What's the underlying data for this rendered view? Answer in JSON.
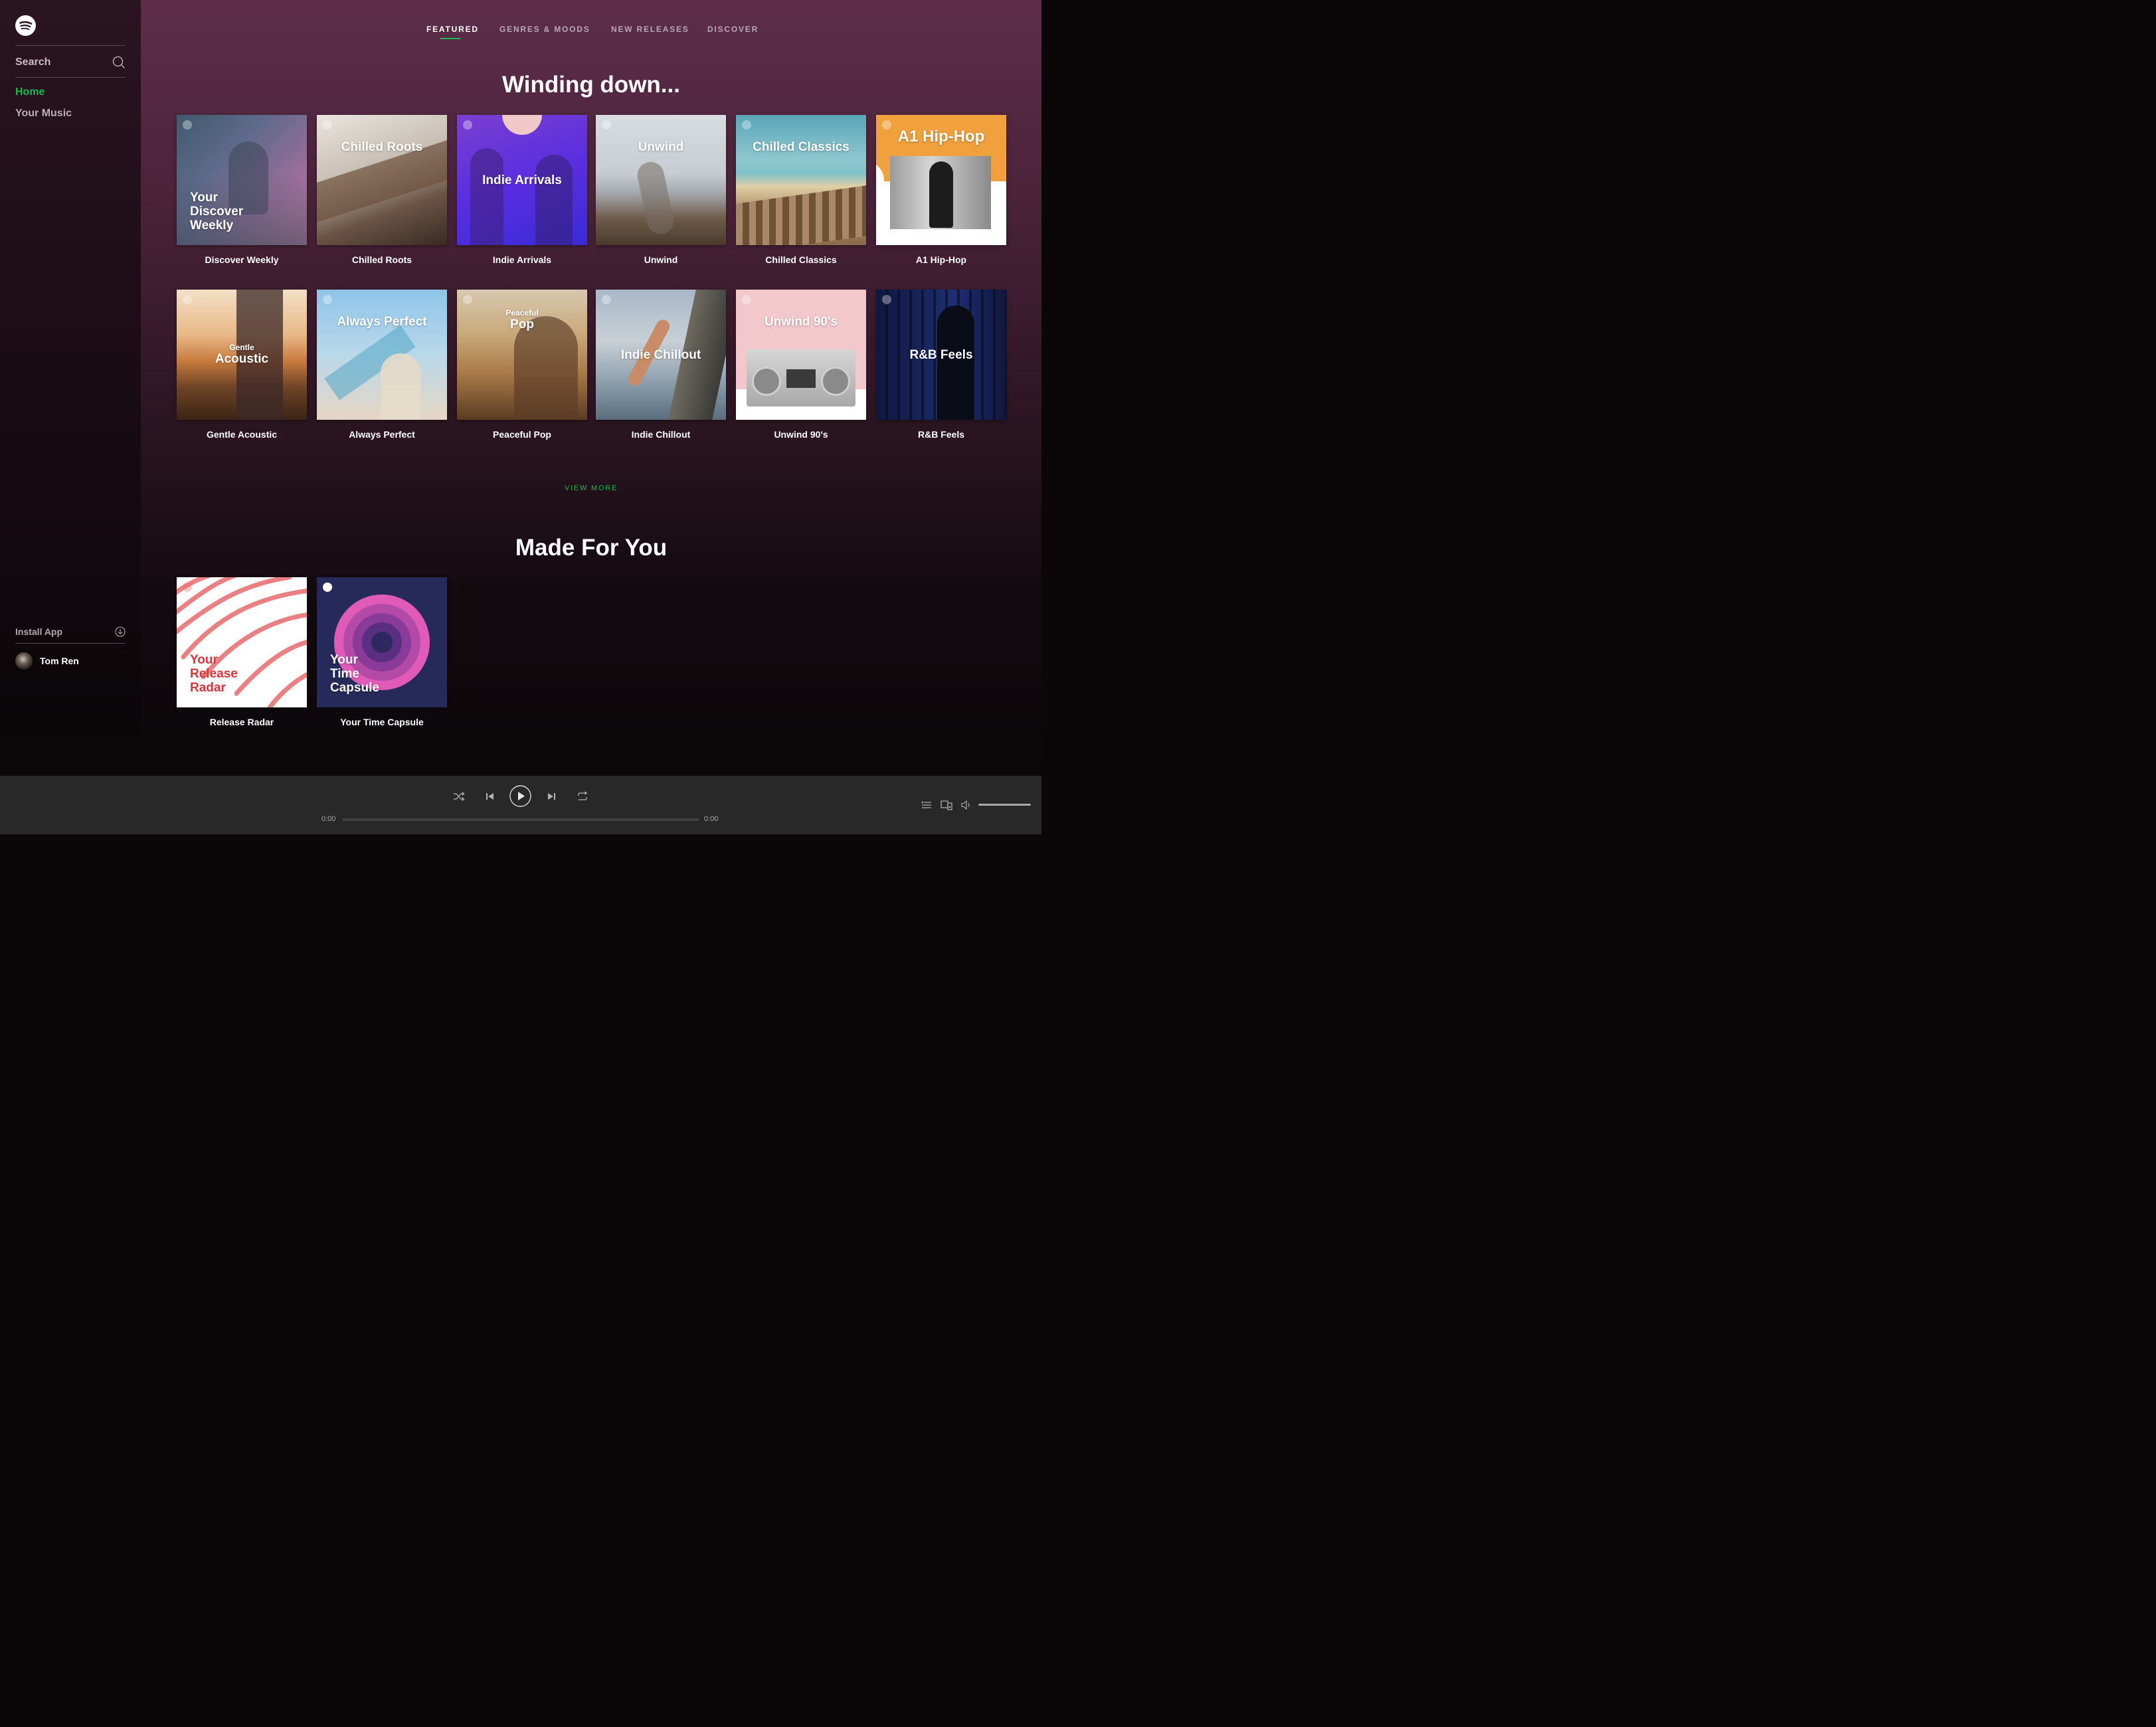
{
  "sidebar": {
    "search_label": "Search",
    "nav": {
      "home": "Home",
      "your_music": "Your Music"
    },
    "install_label": "Install App",
    "user_name": "Tom Ren"
  },
  "tabs": [
    {
      "label": "FEATURED",
      "active": true
    },
    {
      "label": "GENRES & MOODS",
      "active": false
    },
    {
      "label": "NEW RELEASES",
      "active": false
    },
    {
      "label": "DISCOVER",
      "active": false
    }
  ],
  "sections": {
    "winding_down": {
      "title": "Winding down...",
      "view_more": "VIEW MORE",
      "playlists": [
        {
          "title": "Discover Weekly",
          "cover_text": [
            "Your",
            "Discover",
            "Weekly"
          ]
        },
        {
          "title": "Chilled Roots",
          "cover_text": [
            "Chilled Roots"
          ]
        },
        {
          "title": "Indie Arrivals",
          "cover_text": [
            "Indie Arrivals"
          ]
        },
        {
          "title": "Unwind",
          "cover_text": [
            "Unwind"
          ]
        },
        {
          "title": "Chilled Classics",
          "cover_text": [
            "Chilled Classics"
          ]
        },
        {
          "title": "A1 Hip-Hop",
          "cover_text": [
            "A1 Hip-Hop"
          ]
        },
        {
          "title": "Gentle Acoustic",
          "cover_text": [
            "Gentle",
            "Acoustic"
          ]
        },
        {
          "title": "Always Perfect",
          "cover_text": [
            "Always Perfect"
          ]
        },
        {
          "title": "Peaceful Pop",
          "cover_text": [
            "Peaceful",
            "Pop"
          ]
        },
        {
          "title": "Indie Chillout",
          "cover_text": [
            "Indie Chillout"
          ]
        },
        {
          "title": "Unwind 90's",
          "cover_text": [
            "Unwind 90's"
          ]
        },
        {
          "title": "R&B Feels",
          "cover_text": [
            "R&B Feels"
          ]
        }
      ]
    },
    "made_for_you": {
      "title": "Made For You",
      "playlists": [
        {
          "title": "Release Radar",
          "cover_text": [
            "Your",
            "Release",
            "Radar"
          ]
        },
        {
          "title": "Your Time Capsule",
          "cover_text": [
            "Your",
            "Time",
            "Capsule"
          ]
        }
      ]
    }
  },
  "player": {
    "elapsed": "0:00",
    "duration": "0:00",
    "progress": 0,
    "volume": 1.0
  },
  "colors": {
    "accent": "#1db954",
    "player_bg": "#282828"
  }
}
